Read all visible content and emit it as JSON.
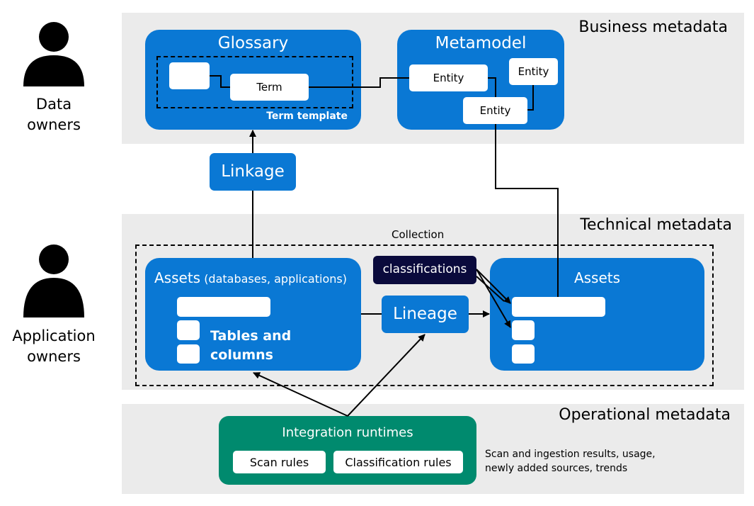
{
  "actors": {
    "data_owners": [
      "Data",
      "owners"
    ],
    "application_owners": [
      "Application",
      "owners"
    ]
  },
  "bands": {
    "business": "Business metadata",
    "technical": "Technical metadata",
    "operational": "Operational metadata"
  },
  "glossary": {
    "title": "Glossary",
    "term": "Term",
    "term_template": "Term template"
  },
  "metamodel": {
    "title": "Metamodel",
    "entities": [
      "Entity",
      "Entity",
      "Entity"
    ]
  },
  "linkage": "Linkage",
  "collection": "Collection",
  "source_assets": {
    "title": "Assets",
    "subtitle": "(databases, applications)",
    "tables_line1": "Tables and",
    "tables_line2": "columns"
  },
  "classifications": "classifications",
  "lineage": "Lineage",
  "target_assets": {
    "title": "Assets"
  },
  "integration": {
    "title": "Integration runtimes",
    "scan_rules": "Scan rules",
    "classification_rules": "Classification rules"
  },
  "operational_note": [
    "Scan and ingestion results, usage,",
    "newly added sources, trends"
  ],
  "colors": {
    "blue": "#0a78d4",
    "navy": "#0a0a3c",
    "green": "#008a6e",
    "band": "#ebebeb"
  }
}
